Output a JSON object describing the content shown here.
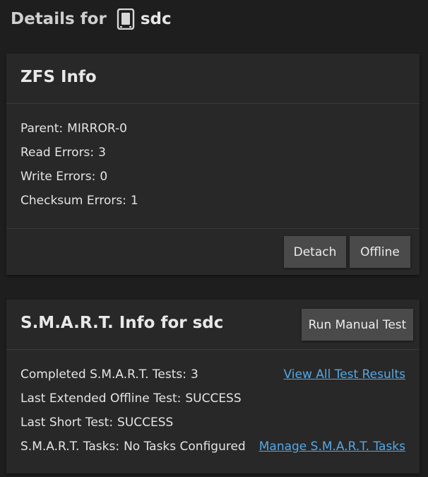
{
  "header": {
    "prefix": "Details for",
    "disk_icon": "drive-icon",
    "disk_name": "sdc"
  },
  "zfs": {
    "title": "ZFS Info",
    "parent_label": "Parent:",
    "parent_value": "MIRROR-0",
    "read_errors_label": "Read Errors:",
    "read_errors_value": "3",
    "write_errors_label": "Write Errors:",
    "write_errors_value": "0",
    "checksum_errors_label": "Checksum Errors:",
    "checksum_errors_value": "1",
    "detach_label": "Detach",
    "offline_label": "Offline"
  },
  "smart": {
    "title": "S.M.A.R.T. Info for sdc",
    "run_test_label": "Run Manual Test",
    "completed_label": "Completed S.M.A.R.T. Tests:",
    "completed_value": "3",
    "view_results_link": "View All Test Results",
    "last_extended_label": "Last Extended Offline Test:",
    "last_extended_value": "SUCCESS",
    "last_short_label": "Last Short Test:",
    "last_short_value": "SUCCESS",
    "tasks_label": "S.M.A.R.T. Tasks:",
    "tasks_value": "No Tasks Configured",
    "manage_tasks_link": "Manage S.M.A.R.T. Tasks"
  },
  "colors": {
    "background": "#1e1e1e",
    "card": "#282828",
    "button": "#4a4a4a",
    "link": "#55a8e6"
  }
}
